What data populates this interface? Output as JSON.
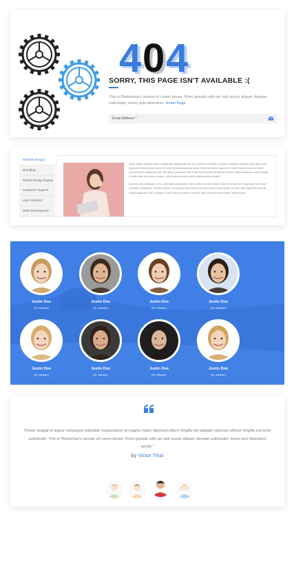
{
  "error_page": {
    "code": "404",
    "heading": "SORRY, THIS PAGE ISN'T AVAILABLE :(",
    "description": "This is Photoshop's version of Lorem Ipsum. Proin gravida nibh vel velit auctor aliquet. Aenean sollicitudin, lorem quis bibendum.",
    "home_link": "Home Page",
    "email_placeholder": "Email Address *",
    "colors": {
      "accent": "#3b7ddd",
      "gear": "#222222"
    }
  },
  "tabs_widget": {
    "tabs": [
      {
        "label": "Website Design"
      },
      {
        "label": "Branding"
      },
      {
        "label": "Retina Ready Display"
      },
      {
        "label": "Customer Support"
      },
      {
        "label": "User Interface"
      },
      {
        "label": "Web Development"
      }
    ],
    "paragraph_1": "Nulla mattis volutpat dolor sollicitudin aliquamque ac illo inventore veritatis et quasi architecto beatae vitae dicta sunt explicabo nemo ipsam dolor sit amet gravida egestas lacus. Morbi sit amet mauris mi. Lorem ipsum dolor sit amet, consectetuer adipiscing elit, sed diam nonummy nibh euismod tincidunt ut laoreet dolore magna aliquam erat volutpat. Ut wisi enim ad minim veniam, quis nostrud exerci tation ullamcorper suscipit.",
    "paragraph_2": "Lobortis nisl ut aliquip ex ea commodo consequat. Duis autem vel eum iriure dolor in hendrerit in vulputate velit esse molestie consequat, vel illum dolore eu feugiat nulla facilisis at vero eros et accumsan et iusto odio dignissimlobortis magna aliquam erat volutpat. Ut wisi enim ad minim veniam, quis nostrud exerci tation ullamcorper."
  },
  "team": {
    "members": [
      {
        "name": "Justin Doe",
        "role": "(Sr. Adviser)"
      },
      {
        "name": "Justin Doe",
        "role": "(Sr. Adviser)"
      },
      {
        "name": "Justin Doe",
        "role": "(Sr. Adviser)"
      },
      {
        "name": "Justin Doe",
        "role": "(Sr. Adviser)"
      },
      {
        "name": "Justin Doe",
        "role": "(Sr. Adviser)"
      },
      {
        "name": "Justin Doe",
        "role": "(Sr. Adviser)"
      },
      {
        "name": "Justin Doe",
        "role": "(Sr. Adviser)"
      },
      {
        "name": "Justin Doe",
        "role": "(Sr. Adviser)"
      }
    ],
    "colors": {
      "overlay": "#3f7fe6"
    }
  },
  "testimonial": {
    "quote": "\"Donec feugiat id augue consequat vulputate Suspendisse at magna mattis dignissim libero fringilla leo aliquam vehicula ultrices fringilla est tortor sollicitudin. This is Photoshop's version of Lorem Ipsum. Proin gravida nibh vel velit auctor aliquet. Aenean sollicitudin, lorem quis bibendum auctor.\"",
    "by_label": "by",
    "author": "Victor Tihai"
  }
}
